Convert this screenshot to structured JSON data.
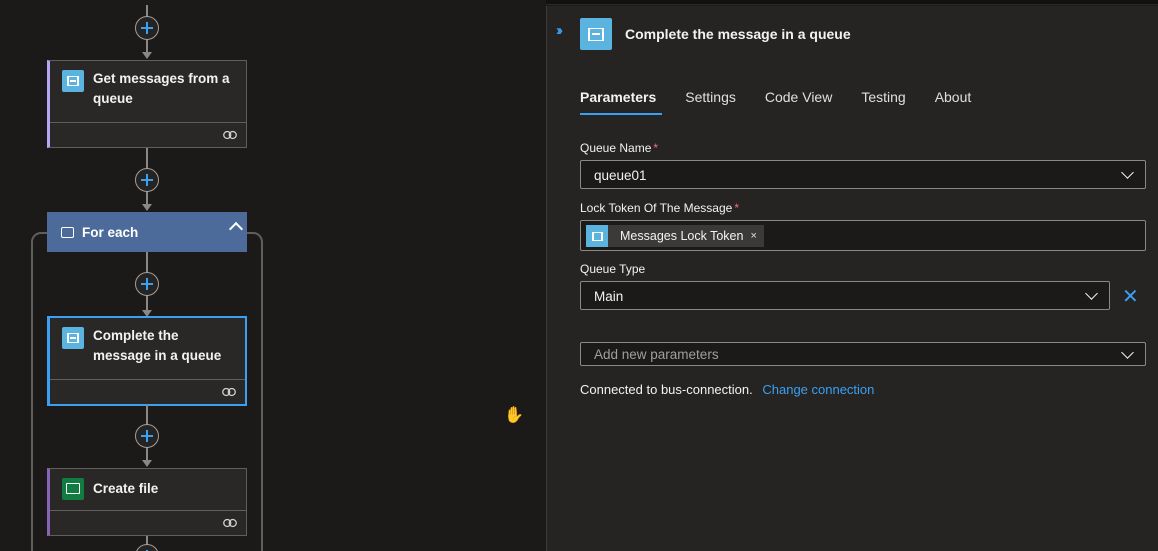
{
  "canvas": {
    "cards": {
      "get_messages": {
        "title": "Get messages from a queue"
      },
      "complete_message": {
        "title": "Complete the message in a queue"
      },
      "create_file": {
        "title": "Create file"
      }
    },
    "foreach": {
      "label": "For each"
    }
  },
  "panel": {
    "title": "Complete the message in a queue",
    "tabs": [
      "Parameters",
      "Settings",
      "Code View",
      "Testing",
      "About"
    ],
    "active_tab": "Parameters",
    "fields": {
      "queue_name": {
        "label": "Queue Name",
        "required_mark": "*",
        "value": "queue01"
      },
      "lock_token": {
        "label": "Lock Token Of The Message",
        "required_mark": "*",
        "token": "Messages Lock Token",
        "token_remove": "×"
      },
      "queue_type": {
        "label": "Queue Type",
        "value": "Main",
        "clear": "✕"
      },
      "add_params": {
        "placeholder": "Add new parameters"
      }
    },
    "connection": {
      "text": "Connected to bus-connection.",
      "link": "Change connection"
    }
  },
  "colors": {
    "accent": "#3aa0f3",
    "foreach_header": "#4c6b9a",
    "queue_icon": "#5bb4e0",
    "file_icon": "#107c41"
  }
}
